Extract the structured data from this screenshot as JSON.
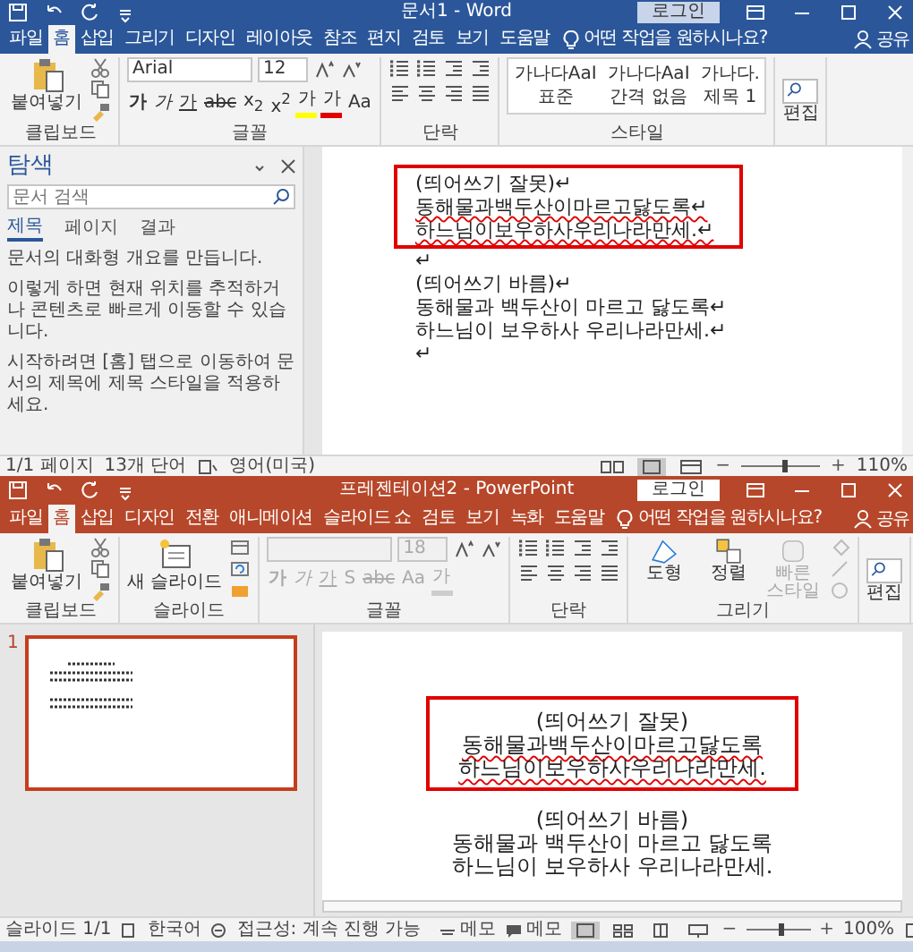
{
  "word": {
    "title": "문서1 - Word",
    "login": "로그인",
    "tabs": [
      {
        "label": "파일",
        "selected": false
      },
      {
        "label": "홈",
        "selected": true
      },
      {
        "label": "삽입",
        "selected": false
      },
      {
        "label": "그리기",
        "selected": false
      },
      {
        "label": "디자인",
        "selected": false
      },
      {
        "label": "레이아웃",
        "selected": false
      },
      {
        "label": "참조",
        "selected": false
      },
      {
        "label": "편지",
        "selected": false
      },
      {
        "label": "검토",
        "selected": false
      },
      {
        "label": "보기",
        "selected": false
      },
      {
        "label": "도움말",
        "selected": false
      }
    ],
    "tell_me": "어떤 작업을 원하시나요?",
    "share": "공유",
    "ribbon": {
      "groups": [
        {
          "kind": "clipboard",
          "label": "클립보드",
          "button": "붙여넣기"
        },
        {
          "kind": "font",
          "label": "글꼴",
          "font_name": "Arial",
          "font_size": "12",
          "disabled": false,
          "buttons": [
            {
              "label": "가",
              "kind": "bold"
            },
            {
              "label": "가",
              "kind": "italic"
            },
            {
              "label": "가",
              "kind": "underline"
            },
            {
              "label": "abc",
              "kind": "strike"
            },
            {
              "label": "x$_{2}$",
              "kind": "plain"
            },
            {
              "label": "x$^{2}$",
              "kind": "plain"
            },
            {
              "label": "가",
              "kind": "highlight"
            },
            {
              "label": "가",
              "kind": "font_color"
            },
            {
              "label": "Aa",
              "kind": "plain"
            }
          ]
        },
        {
          "kind": "paragraph",
          "label": "단락"
        },
        {
          "kind": "styles",
          "label": "스타일",
          "styles": [
            {
              "sample": "가나다AaI",
              "name": "표준"
            },
            {
              "sample": "가나다AaI",
              "name": "간격 없음"
            },
            {
              "sample": "가나다.",
              "name": "제목 1"
            }
          ]
        },
        {
          "kind": "editing",
          "button": "편집"
        }
      ]
    },
    "nav_pane": {
      "title": "탐색",
      "search_placeholder": "문서 검색",
      "tabs": [
        {
          "label": "제목",
          "selected": true
        },
        {
          "label": "페이지",
          "selected": false
        },
        {
          "label": "결과",
          "selected": false
        }
      ],
      "paragraphs": [
        "문서의 대화형 개요를 만듭니다.",
        "이렇게 하면 현재 위치를 추적하거나 콘텐츠로 빠르게 이동할 수 있습니다.",
        "시작하려면 [홈] 탭으로 이동하여 문서의 제목에 제목 스타일을 적용하세요."
      ]
    },
    "document": {
      "blocks": [
        {
          "boxed": true,
          "lines": [
            {
              "text": "(띄어쓰기 잘못)↵",
              "spell_error": false
            },
            {
              "text": "동해물과백두산이마르고닳도록↵",
              "spell_error": true
            },
            {
              "text": "하느님이보우하사우리나라만세.↵",
              "spell_error": true
            }
          ]
        },
        {
          "boxed": false,
          "lines": [
            {
              "text": "↵",
              "spell_error": false
            },
            {
              "text": "(띄어쓰기 바름)↵",
              "spell_error": false
            },
            {
              "text": "동해물과 백두산이 마르고 닳도록↵",
              "spell_error": false
            },
            {
              "text": "하느님이 보우하사 우리나라만세.↵",
              "spell_error": false
            },
            {
              "text": "↵",
              "spell_error": false
            }
          ]
        }
      ]
    },
    "status_bar": {
      "items": [
        "1/1 페이지",
        "13개 단어",
        "영어(미국)"
      ],
      "views": [
        {
          "kind": "read",
          "selected": false
        },
        {
          "kind": "print",
          "selected": true
        },
        {
          "kind": "web",
          "selected": false
        }
      ],
      "zoom": {
        "out": "−",
        "in": "+",
        "level": 0.55,
        "label": "110%"
      }
    }
  },
  "powerpoint": {
    "title": "프레젠테이션2 - PowerPoint",
    "login": "로그인",
    "tabs": [
      {
        "label": "파일",
        "selected": false
      },
      {
        "label": "홈",
        "selected": true
      },
      {
        "label": "삽입",
        "selected": false
      },
      {
        "label": "디자인",
        "selected": false
      },
      {
        "label": "전환",
        "selected": false
      },
      {
        "label": "애니메이션",
        "selected": false
      },
      {
        "label": "슬라이드 쇼",
        "selected": false
      },
      {
        "label": "검토",
        "selected": false
      },
      {
        "label": "보기",
        "selected": false
      },
      {
        "label": "녹화",
        "selected": false
      },
      {
        "label": "도움말",
        "selected": false
      }
    ],
    "tell_me": "어떤 작업을 원하시나요?",
    "share": "공유",
    "ribbon": {
      "groups": [
        {
          "kind": "clipboard",
          "label": "클립보드",
          "button": "붙여넣기"
        },
        {
          "kind": "slides",
          "label": "슬라이드",
          "button": "새 슬라이드"
        },
        {
          "kind": "font",
          "label": "글꼴",
          "font_size": "18",
          "disabled": true,
          "buttons": [
            {
              "label": "가",
              "kind": "bold"
            },
            {
              "label": "가",
              "kind": "italic"
            },
            {
              "label": "가",
              "kind": "underline"
            },
            {
              "label": "S",
              "kind": "plain"
            },
            {
              "label": "abc",
              "kind": "strike"
            },
            {
              "label": "Aa",
              "kind": "plain"
            },
            {
              "label": "가",
              "kind": "font_color"
            }
          ]
        },
        {
          "kind": "paragraph",
          "label": "단락"
        },
        {
          "kind": "drawing",
          "label": "그리기",
          "buttons": [
            {
              "label": "도형",
              "kind": "shapes",
              "disabled": false
            },
            {
              "label": "정렬",
              "kind": "arrange",
              "disabled": false
            },
            {
              "label": "빠른 스타일",
              "kind": "quick",
              "disabled": true
            }
          ]
        },
        {
          "kind": "editing",
          "button": "편집"
        }
      ]
    },
    "slide_panel": {
      "slides": [
        {
          "number": "1",
          "selected": true
        }
      ]
    },
    "slide": {
      "blocks": [
        {
          "boxed": true,
          "lines": [
            {
              "text": "(띄어쓰기 잘못)",
              "spell_error": false
            },
            {
              "text": "동해물과백두산이마르고닳도록",
              "spell_error": true
            },
            {
              "text": "하느님이보우하사우리나라만세.",
              "spell_error": true
            }
          ]
        },
        {
          "boxed": false,
          "lines": [
            {
              "text": "(띄어쓰기 바름)",
              "spell_error": false
            },
            {
              "text": "동해물과 백두산이 마르고 닳도록",
              "spell_error": false
            },
            {
              "text": "하느님이 보우하사 우리나라만세.",
              "spell_error": false
            }
          ]
        }
      ]
    },
    "status_bar": {
      "items": [
        "슬라이드 1/1",
        "한국어",
        "접근성: 계속 진행 가능"
      ],
      "notes": "메모",
      "comments": "메모",
      "views": [
        {
          "kind": "normal",
          "selected": true
        },
        {
          "kind": "sorter",
          "selected": false
        },
        {
          "kind": "reading",
          "selected": false
        },
        {
          "kind": "show",
          "selected": false
        }
      ],
      "zoom": {
        "out": "−",
        "in": "+",
        "level": 0.55,
        "label": "100%"
      }
    }
  }
}
